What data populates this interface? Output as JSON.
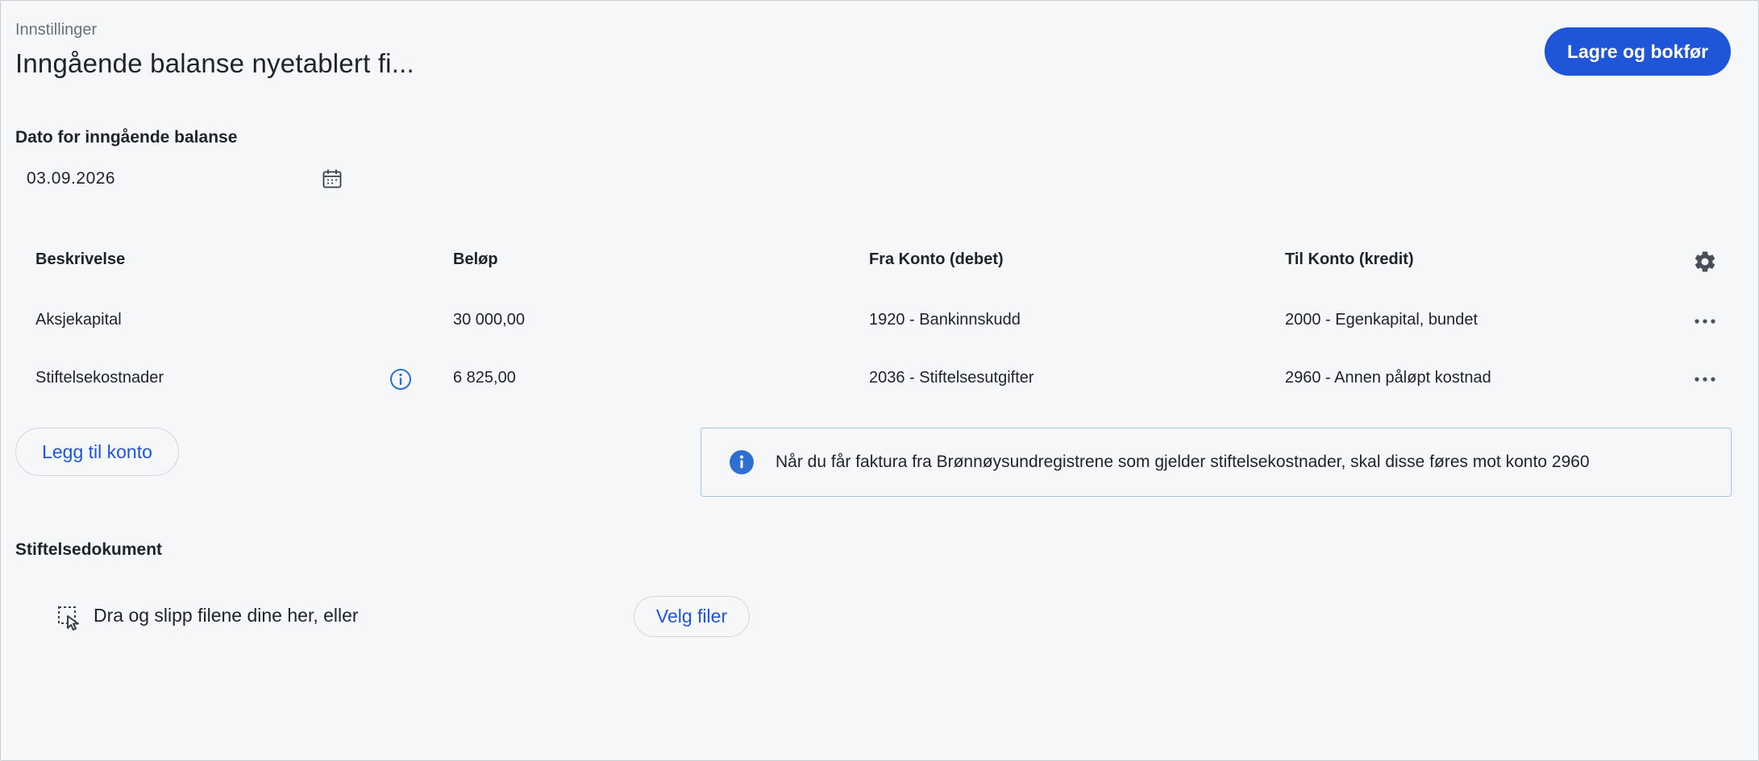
{
  "header": {
    "breadcrumb": "Innstillinger",
    "title": "Inngående balanse nyetablert fi...",
    "save_button": "Lagre og bokfør"
  },
  "date": {
    "label": "Dato for inngående balanse",
    "value": "03.09.2026",
    "icon": "calendar-icon"
  },
  "table": {
    "columns": [
      "Beskrivelse",
      "Beløp",
      "Fra Konto (debet)",
      "Til Konto (kredit)"
    ],
    "settings_icon": "gear-icon",
    "rows": [
      {
        "description": "Aksjekapital",
        "amount": "30 000,00",
        "from": "1920 - Bankinnskudd",
        "to": "2000 - Egenkapital, bundet",
        "has_info": false
      },
      {
        "description": "Stiftelsekostnader",
        "amount": "6 825,00",
        "from": "2036 - Stiftelsesutgifter",
        "to": "2960 - Annen påløpt kostnad",
        "has_info": true
      }
    ]
  },
  "add_account_button": "Legg til konto",
  "info_message": "Når du får faktura fra Brønnøysundregistrene som gjelder stiftelsekostnader, skal disse føres mot konto 2960",
  "documents": {
    "label": "Stiftelsedokument",
    "drop_text": "Dra og slipp filene dine her, eller",
    "select_button": "Velg filer"
  },
  "colors": {
    "primary": "#1f55d8",
    "info_border": "#a9c4e6",
    "info_icon": "#2f6fd1",
    "background": "#f6f7f9"
  }
}
